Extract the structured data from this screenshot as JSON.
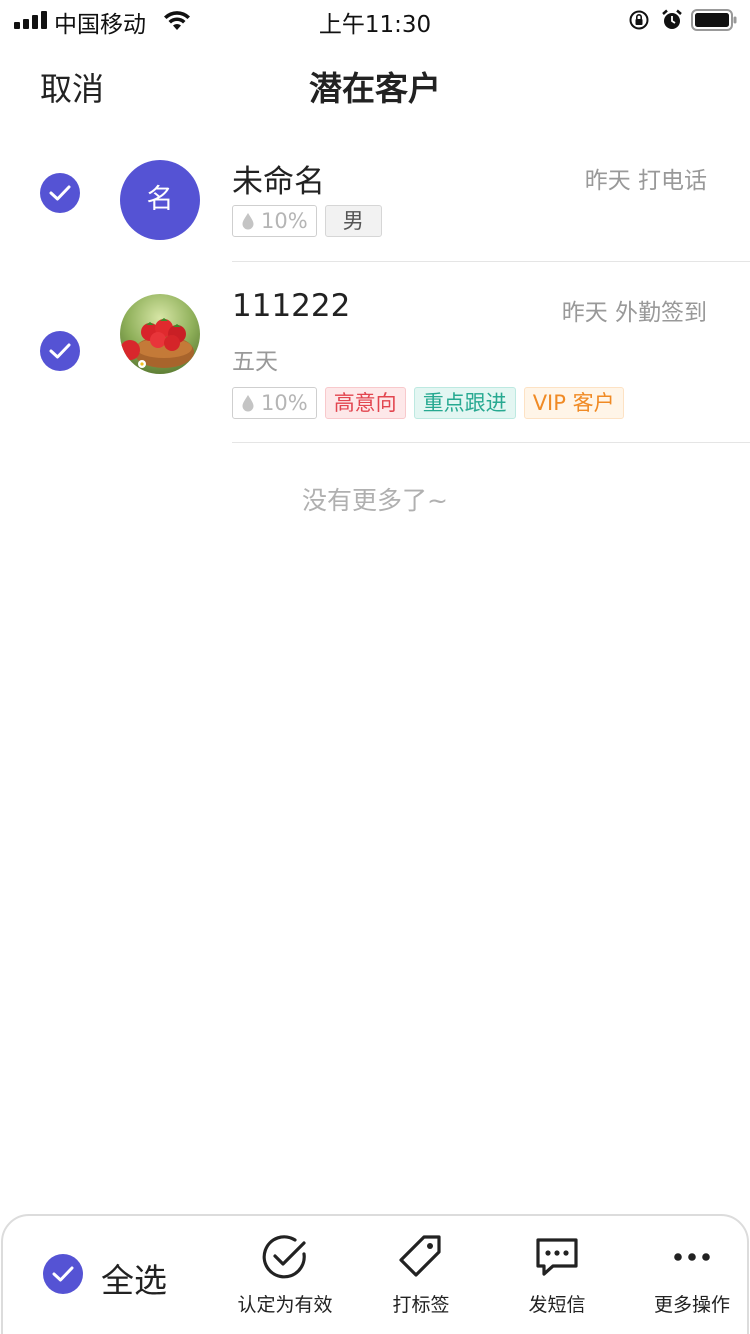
{
  "status_bar": {
    "carrier": "中国移动",
    "time": "上午11:30"
  },
  "nav": {
    "cancel_label": "取消",
    "title": "潜在客户"
  },
  "customers": [
    {
      "name": "未命名",
      "avatar_text": "名",
      "meta": "昨天 打电话",
      "selected": true,
      "tags": {
        "probability": "10%",
        "gender": "男"
      }
    },
    {
      "name": "111222",
      "avatar_image": "strawberry-basket-photo",
      "meta": "昨天 外勤签到",
      "subtitle": "五天",
      "selected": true,
      "tags": {
        "probability": "10%",
        "labels": [
          "高意向",
          "重点跟进",
          "VIP 客户"
        ]
      }
    }
  ],
  "list_end_text": "没有更多了~",
  "bottom_bar": {
    "select_all_label": "全选",
    "actions": [
      {
        "label": "认定为有效",
        "icon": "check-circle-icon"
      },
      {
        "label": "打标签",
        "icon": "tag-icon"
      },
      {
        "label": "发短信",
        "icon": "message-icon"
      },
      {
        "label": "更多操作",
        "icon": "more-icon"
      }
    ]
  },
  "colors": {
    "accent": "#5553d4",
    "tag_red": "#e2454f",
    "tag_teal": "#27a991",
    "tag_orange": "#f08a24",
    "muted_text": "#999999"
  }
}
